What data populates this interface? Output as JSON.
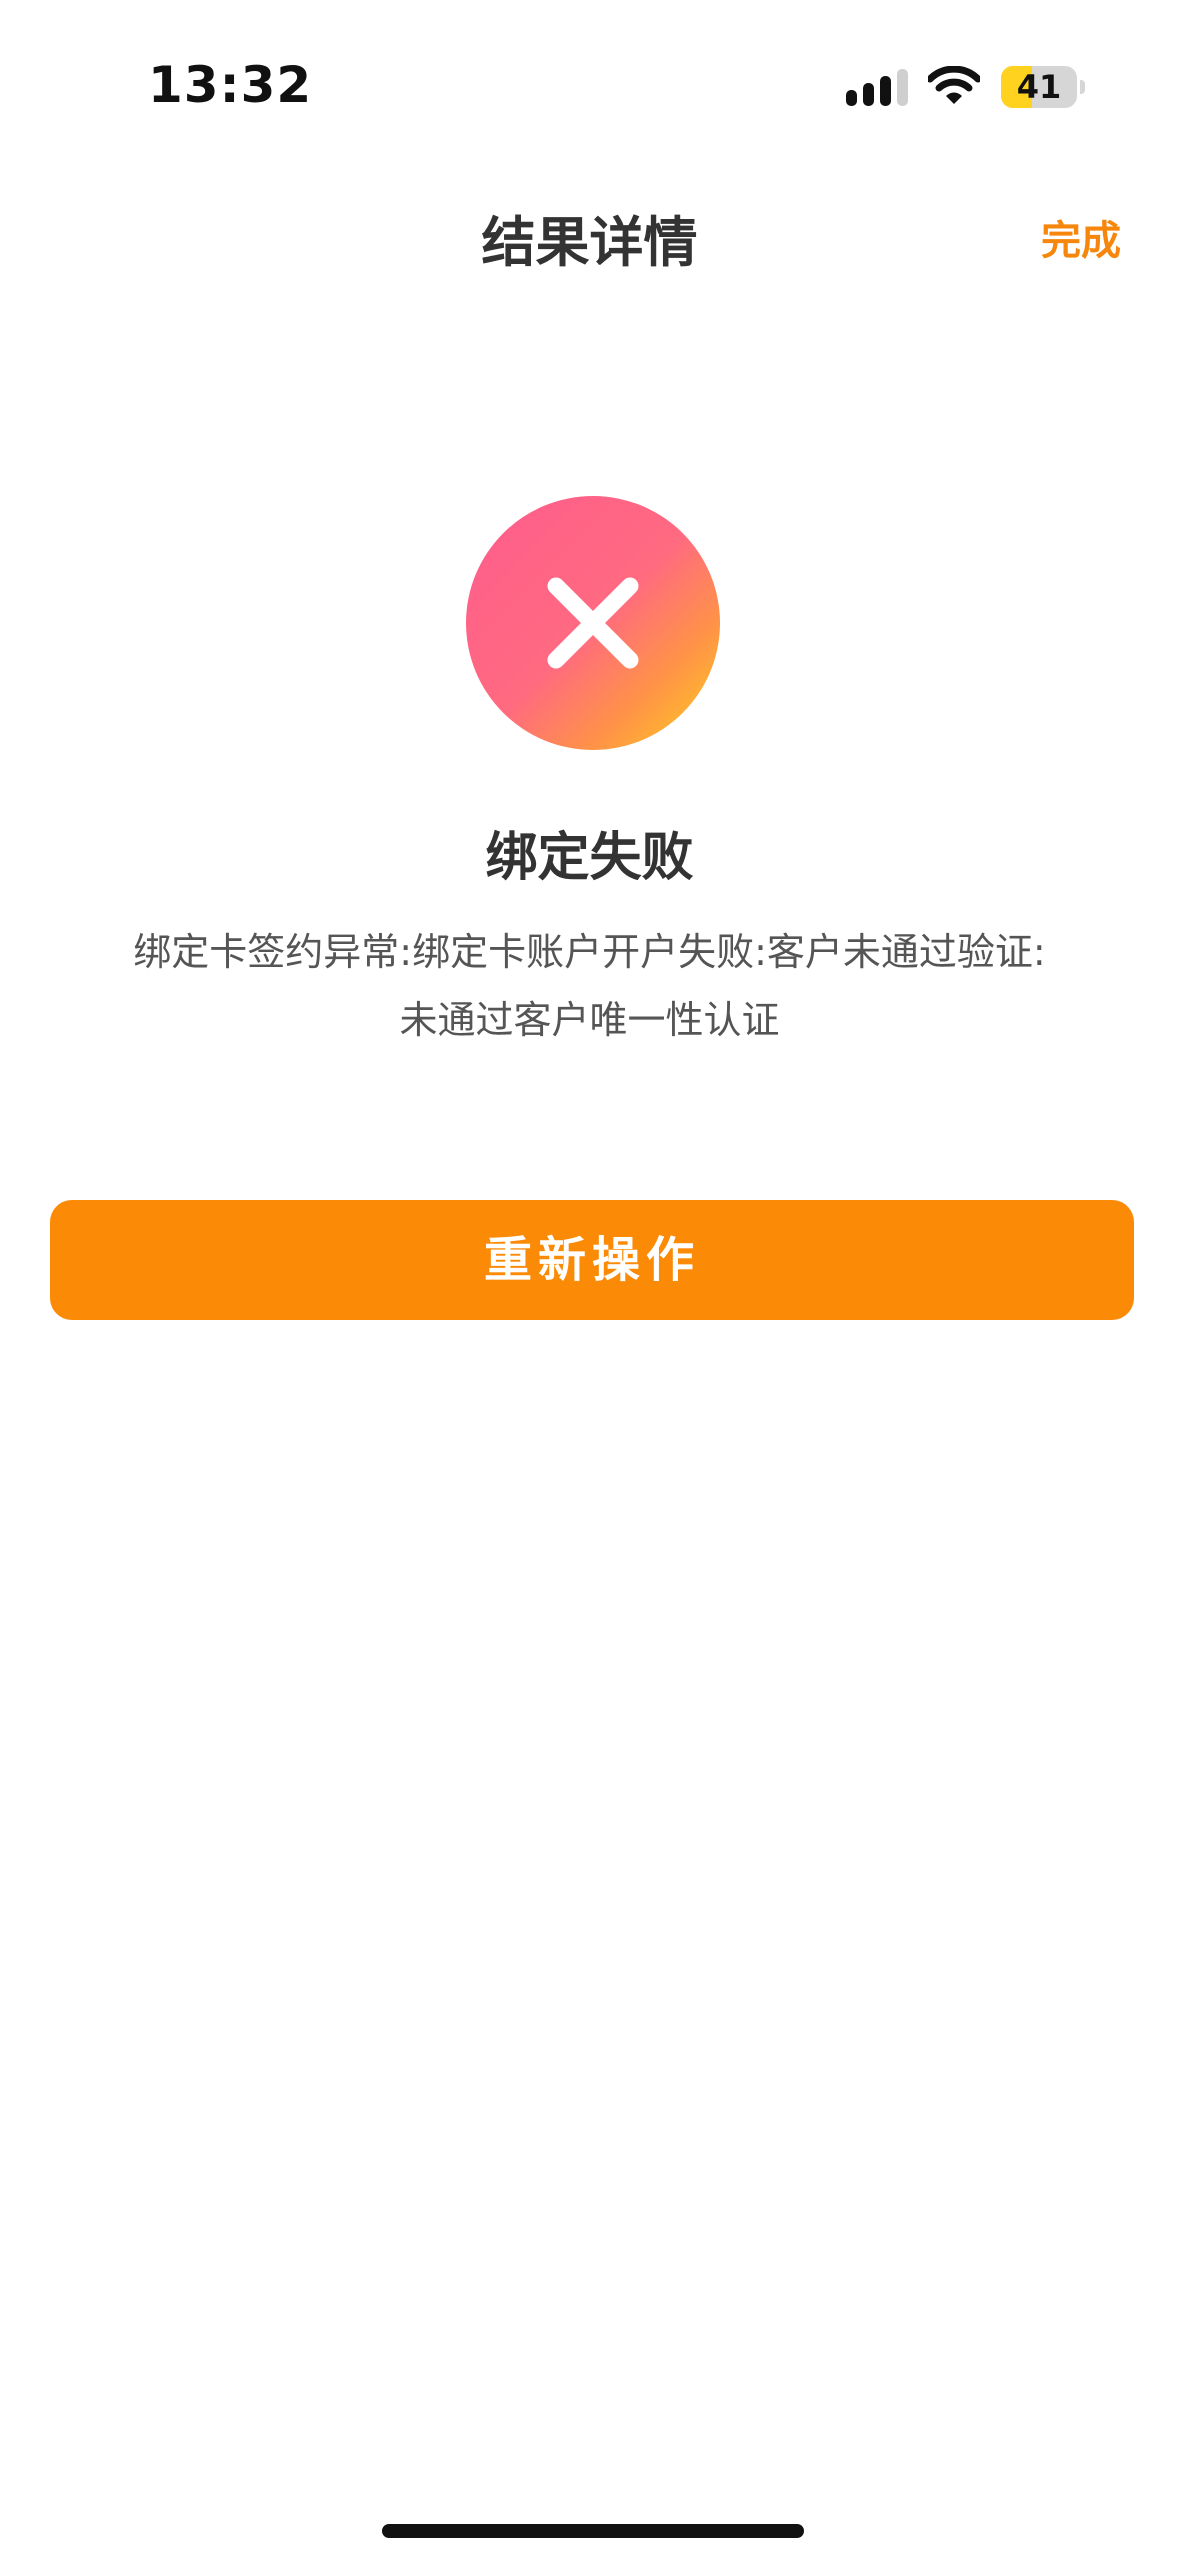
{
  "status_bar": {
    "time": "13:32",
    "battery_level": "41",
    "battery_fraction": 0.41,
    "icons": [
      "signal-icon",
      "wifi-icon",
      "battery-icon"
    ]
  },
  "nav": {
    "title": "结果详情",
    "done_label": "完成"
  },
  "result": {
    "icon": "close-icon",
    "title": "绑定失败",
    "message_line1": "绑定卡签约异常:绑定卡账户开户失败:客户未通过验证:",
    "message_line2": "未通过客户唯一性认证"
  },
  "actions": {
    "retry_label": "重新操作"
  },
  "colors": {
    "accent": "#fb8a07",
    "done_text": "#f6870c",
    "icon_gradient_start": "#ff5c8d",
    "icon_gradient_end": "#ffd21c"
  }
}
